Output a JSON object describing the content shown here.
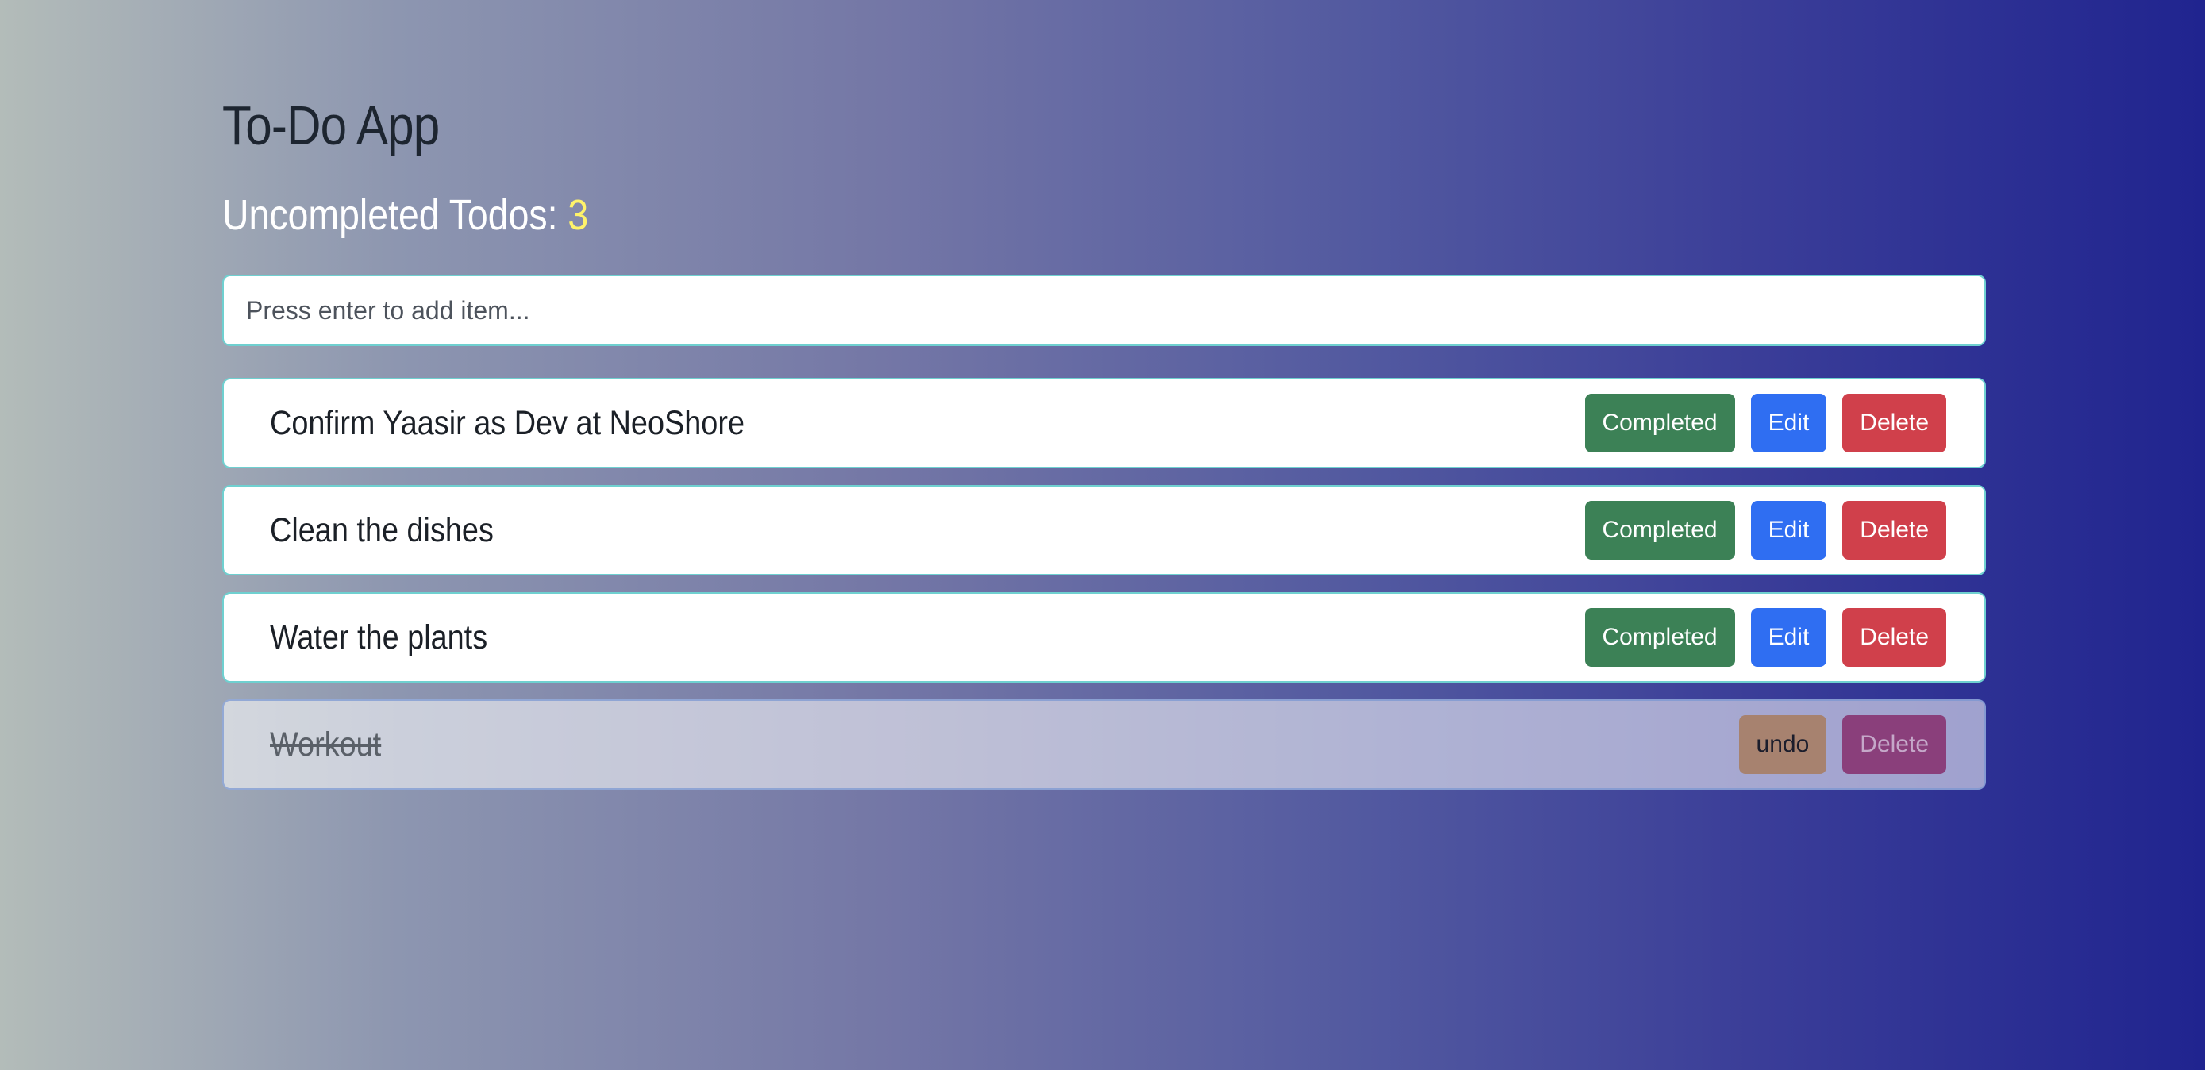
{
  "app": {
    "title": "To-Do App"
  },
  "counter": {
    "label": "Uncompleted Todos: ",
    "count": "3"
  },
  "input": {
    "placeholder": "Press enter to add item..."
  },
  "todos": [
    {
      "text": "Confirm Yaasir as Dev at NeoShore",
      "completed": false,
      "completed_label": "Completed",
      "edit_label": "Edit",
      "delete_label": "Delete"
    },
    {
      "text": "Clean the dishes",
      "completed": false,
      "completed_label": "Completed",
      "edit_label": "Edit",
      "delete_label": "Delete"
    },
    {
      "text": "Water the plants",
      "completed": false,
      "completed_label": "Completed",
      "edit_label": "Edit",
      "delete_label": "Delete"
    },
    {
      "text": "Workout",
      "completed": true,
      "undo_label": "undo",
      "delete_label": "Delete"
    }
  ],
  "colors": {
    "accent_count": "#fff36a",
    "completed_button": "#3c8156",
    "edit_button": "#2f6ef2",
    "delete_button": "#d0404b",
    "undo_button": "#a7826f",
    "border": "#6fd0d0"
  }
}
